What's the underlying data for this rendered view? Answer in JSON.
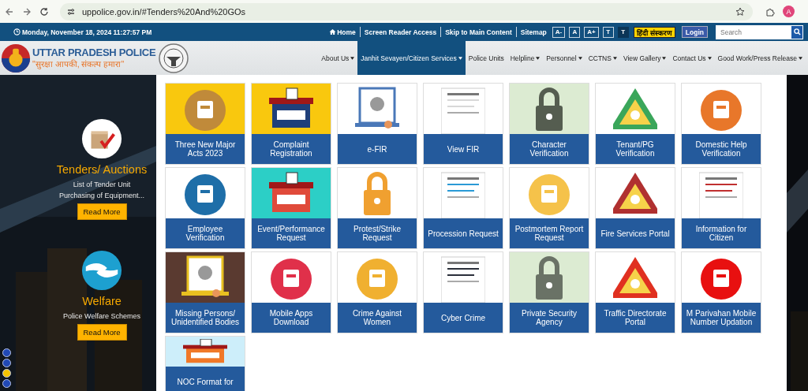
{
  "browser": {
    "url": "uppolice.gov.in/#Tenders%20And%20GOs",
    "avatar": "A"
  },
  "topbar": {
    "datetime": "Monday, November 18, 2024 11:27:57 PM",
    "links": [
      {
        "label": "Home",
        "kind": "home"
      },
      {
        "label": "Screen Reader Access",
        "kind": "plain"
      },
      {
        "label": "Skip to Main Content",
        "kind": "plain"
      },
      {
        "label": "Sitemap",
        "kind": "plain"
      }
    ],
    "font_buttons": [
      {
        "label": "A-",
        "selected": false
      },
      {
        "label": "A",
        "selected": false
      },
      {
        "label": "A+",
        "selected": false
      },
      {
        "label": "T",
        "selected": false
      },
      {
        "label": "T",
        "selected": true
      }
    ],
    "language_button": "हिंदी संस्करण",
    "login_button": "Login",
    "search": {
      "placeholder": "Search"
    }
  },
  "header": {
    "title": "UTTAR PRADESH POLICE",
    "tagline": "\"सुरक्षा आपकी, संकल्प हमारा\"",
    "nav": [
      {
        "label": "About Us",
        "dropdown": true,
        "selected": false
      },
      {
        "label": "Janhit Sevayen/Citizen Services",
        "dropdown": true,
        "selected": true
      },
      {
        "label": "Police Units",
        "dropdown": false,
        "selected": false
      },
      {
        "label": "Helpline",
        "dropdown": true,
        "selected": false
      },
      {
        "label": "Personnel",
        "dropdown": true,
        "selected": false
      },
      {
        "label": "CCTNS",
        "dropdown": true,
        "selected": false
      },
      {
        "label": "View Gallery",
        "dropdown": true,
        "selected": false
      },
      {
        "label": "Contact Us",
        "dropdown": true,
        "selected": false
      },
      {
        "label": "Good Work/Press Release",
        "dropdown": true,
        "selected": false
      }
    ]
  },
  "slides": [
    {
      "kind": "ballot",
      "title": "Tenders/ Auctions",
      "description": "List of Tender Unit Purchasing of Equipment...",
      "button": "Read More"
    },
    {
      "kind": "hands",
      "title": "Welfare",
      "description": "Police Welfare Schemes",
      "button": "Read More"
    }
  ],
  "carousel_dots": [
    {
      "selected": false
    },
    {
      "selected": false
    },
    {
      "selected": true
    },
    {
      "selected": false
    }
  ],
  "services": [
    {
      "label": "Three New Major Acts 2023"
    },
    {
      "label": "Complaint Registration"
    },
    {
      "label": "e-FIR"
    },
    {
      "label": "View FIR"
    },
    {
      "label": "Character Verification"
    },
    {
      "label": "Tenant/PG Verification"
    },
    {
      "label": "Domestic Help Verification"
    },
    {
      "label": "Employee Verification"
    },
    {
      "label": "Event/Performance Request"
    },
    {
      "label": "Protest/Strike Request"
    },
    {
      "label": "Procession Request"
    },
    {
      "label": "Postmortem Report Request"
    },
    {
      "label": "Fire Services Portal"
    },
    {
      "label": "Information for Citizen"
    },
    {
      "label": "Missing Persons/ Unidentified Bodies"
    },
    {
      "label": "Mobile Apps Download"
    },
    {
      "label": "Crime Against Women"
    },
    {
      "label": "Cyber Crime"
    },
    {
      "label": "Private Security Agency"
    },
    {
      "label": "Traffic Directorate Portal"
    },
    {
      "label": "M Parivahan Mobile Number Updation"
    },
    {
      "label": "NOC Format for"
    }
  ]
}
